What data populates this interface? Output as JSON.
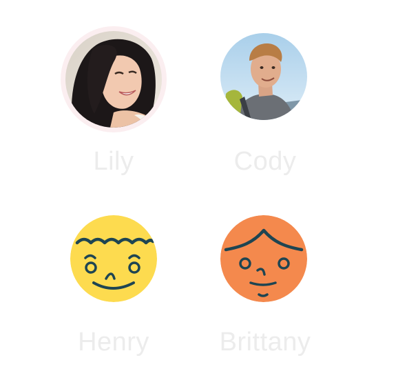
{
  "profiles": [
    {
      "name": "Lily",
      "avatar": "photo-woman-avatar",
      "selected": true
    },
    {
      "name": "Cody",
      "avatar": "photo-man-avatar",
      "selected": false
    },
    {
      "name": "Henry",
      "avatar": "yellow-face-icon",
      "selected": false
    },
    {
      "name": "Brittany",
      "avatar": "orange-face-icon",
      "selected": false
    }
  ],
  "colors": {
    "name_text": "#ececec",
    "selection_ring": "#fbeef0",
    "henry_face": "#fddb4f",
    "brittany_face": "#f4894d",
    "face_lines": "#1e4552"
  }
}
